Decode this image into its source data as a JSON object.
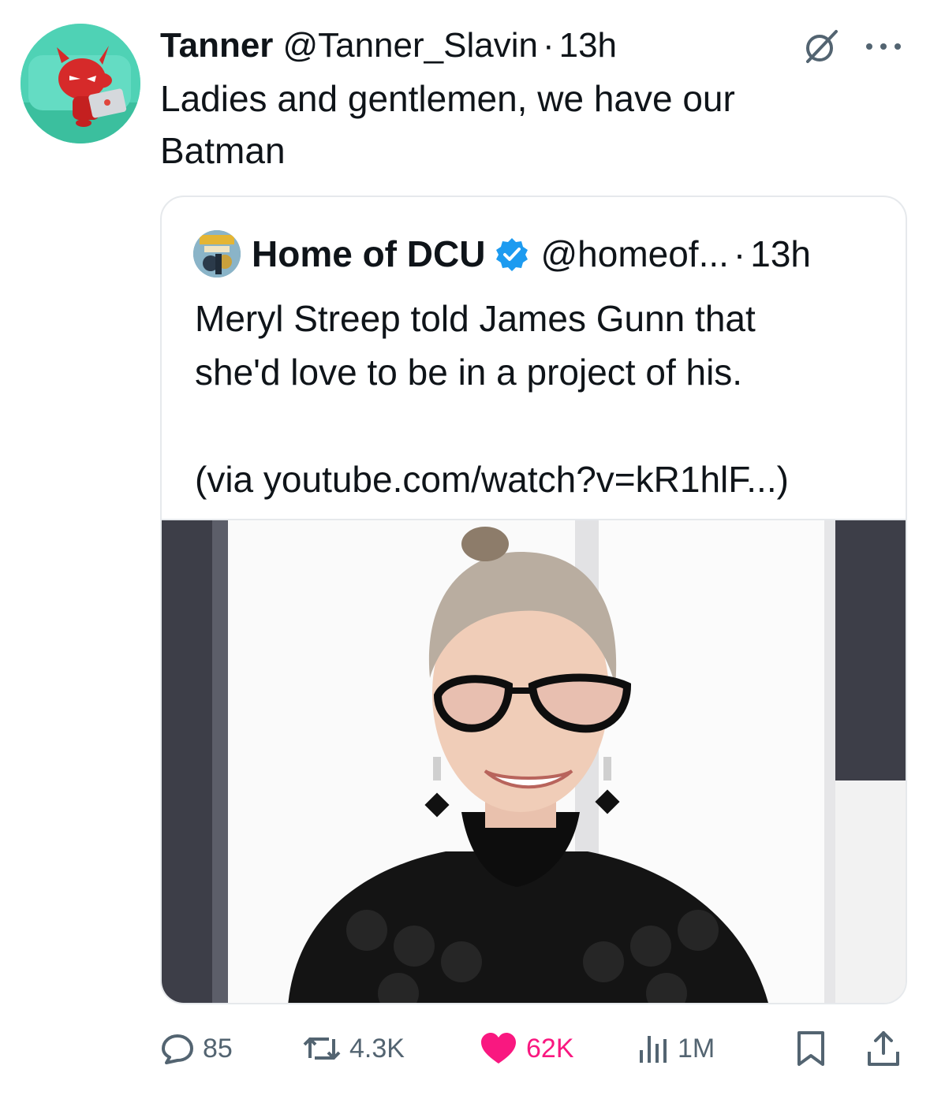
{
  "tweet": {
    "author_name": "Tanner",
    "author_handle": "@Tanner_Slavin",
    "separator": "·",
    "time": "13h",
    "text_line1": "Ladies and gentlemen, we have our",
    "text_line2": "Batman"
  },
  "quoted": {
    "author_name": "Home of DCU",
    "author_handle": "@homeof...",
    "separator": "·",
    "time": "13h",
    "text_line1": "Meryl Streep told James Gunn that",
    "text_line2": "she'd love to be in a project of his.",
    "text_line3": "(via youtube.com/watch?v=kR1hlF...)",
    "verified": true,
    "verified_color": "#1d9bf0"
  },
  "actions": {
    "replies": "85",
    "reposts": "4.3K",
    "likes": "62K",
    "views": "1M"
  },
  "colors": {
    "text": "#0f1419",
    "secondary": "#536471",
    "like": "#f91880",
    "border": "#e6e9ec"
  },
  "icons": [
    "grok-icon",
    "more-icon",
    "verified-icon",
    "reply-icon",
    "repost-icon",
    "like-icon",
    "views-icon",
    "bookmark-icon",
    "share-icon"
  ]
}
